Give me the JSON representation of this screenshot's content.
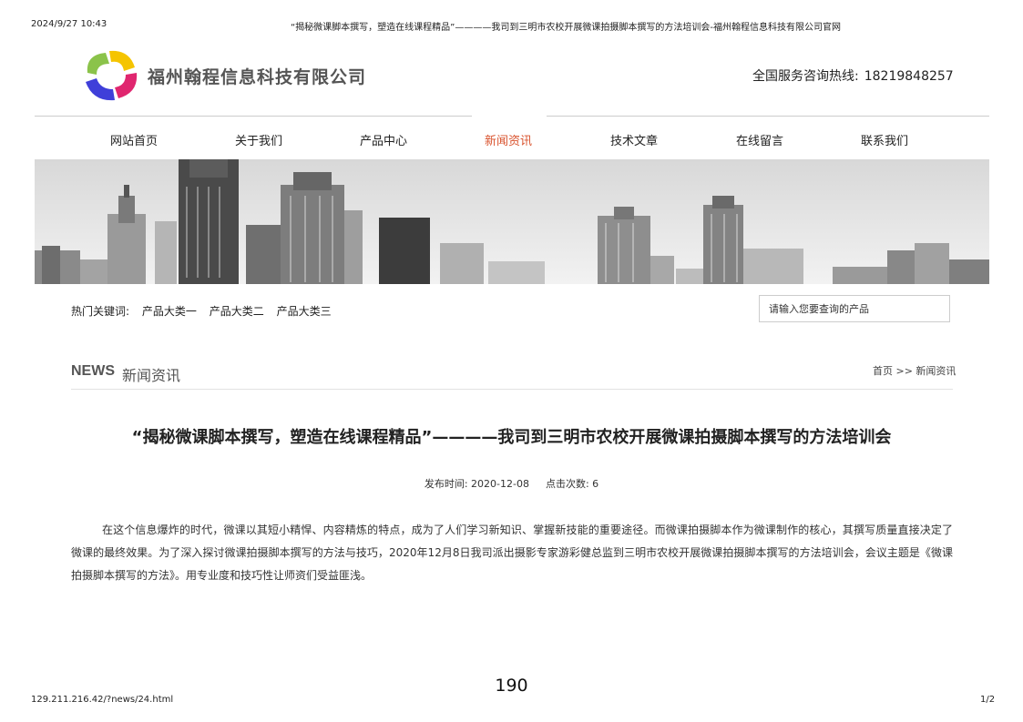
{
  "print_header": {
    "datetime": "2024/9/27 10:43",
    "doc_title": "“揭秘微课脚本撰写，塑造在线课程精品”————我司到三明市农校开展微课拍摄脚本撰写的方法培训会-福州翰程信息科技有限公司官网"
  },
  "site": {
    "company_name": "福州翰程信息科技有限公司",
    "hotline_label": "全国服务咨询热线:",
    "hotline_number": "18219848257"
  },
  "nav": {
    "items": [
      {
        "label": "网站首页"
      },
      {
        "label": "关于我们"
      },
      {
        "label": "产品中心"
      },
      {
        "label": "新闻资讯",
        "active": true
      },
      {
        "label": "技术文章"
      },
      {
        "label": "在线留言"
      },
      {
        "label": "联系我们"
      }
    ],
    "active_color": "#d9532e"
  },
  "hot": {
    "label": "热门关键词:",
    "keywords": [
      "产品大类一",
      "产品大类二",
      "产品大类三"
    ]
  },
  "search": {
    "placeholder": "请输入您要查询的产品"
  },
  "section": {
    "title_en": "NEWS",
    "title_cn": "新闻资讯",
    "breadcrumb": "首页 >> 新闻资讯"
  },
  "article": {
    "title": "“揭秘微课脚本撰写，塑造在线课程精品”————我司到三明市农校开展微课拍摄脚本撰写的方法培训会",
    "publish_time": "发布时间: 2020-12-08",
    "clicks": "点击次数: 6",
    "body": "在这个信息爆炸的时代，微课以其短小精悍、内容精炼的特点，成为了人们学习新知识、掌握新技能的重要途径。而微课拍摄脚本作为微课制作的核心，其撰写质量直接决定了微课的最终效果。为了深入探讨微课拍摄脚本撰写的方法与技巧，2020年12月8日我司派出摄影专家游彩健总监到三明市农校开展微课拍摄脚本撰写的方法培训会，会议主题是《微课拍摄脚本撰写的方法》。用专业度和技巧性让师资们受益匪浅。"
  },
  "page_number": "190",
  "print_footer": {
    "url": "129.211.216.42/?news/24.html",
    "page": "1/2"
  }
}
